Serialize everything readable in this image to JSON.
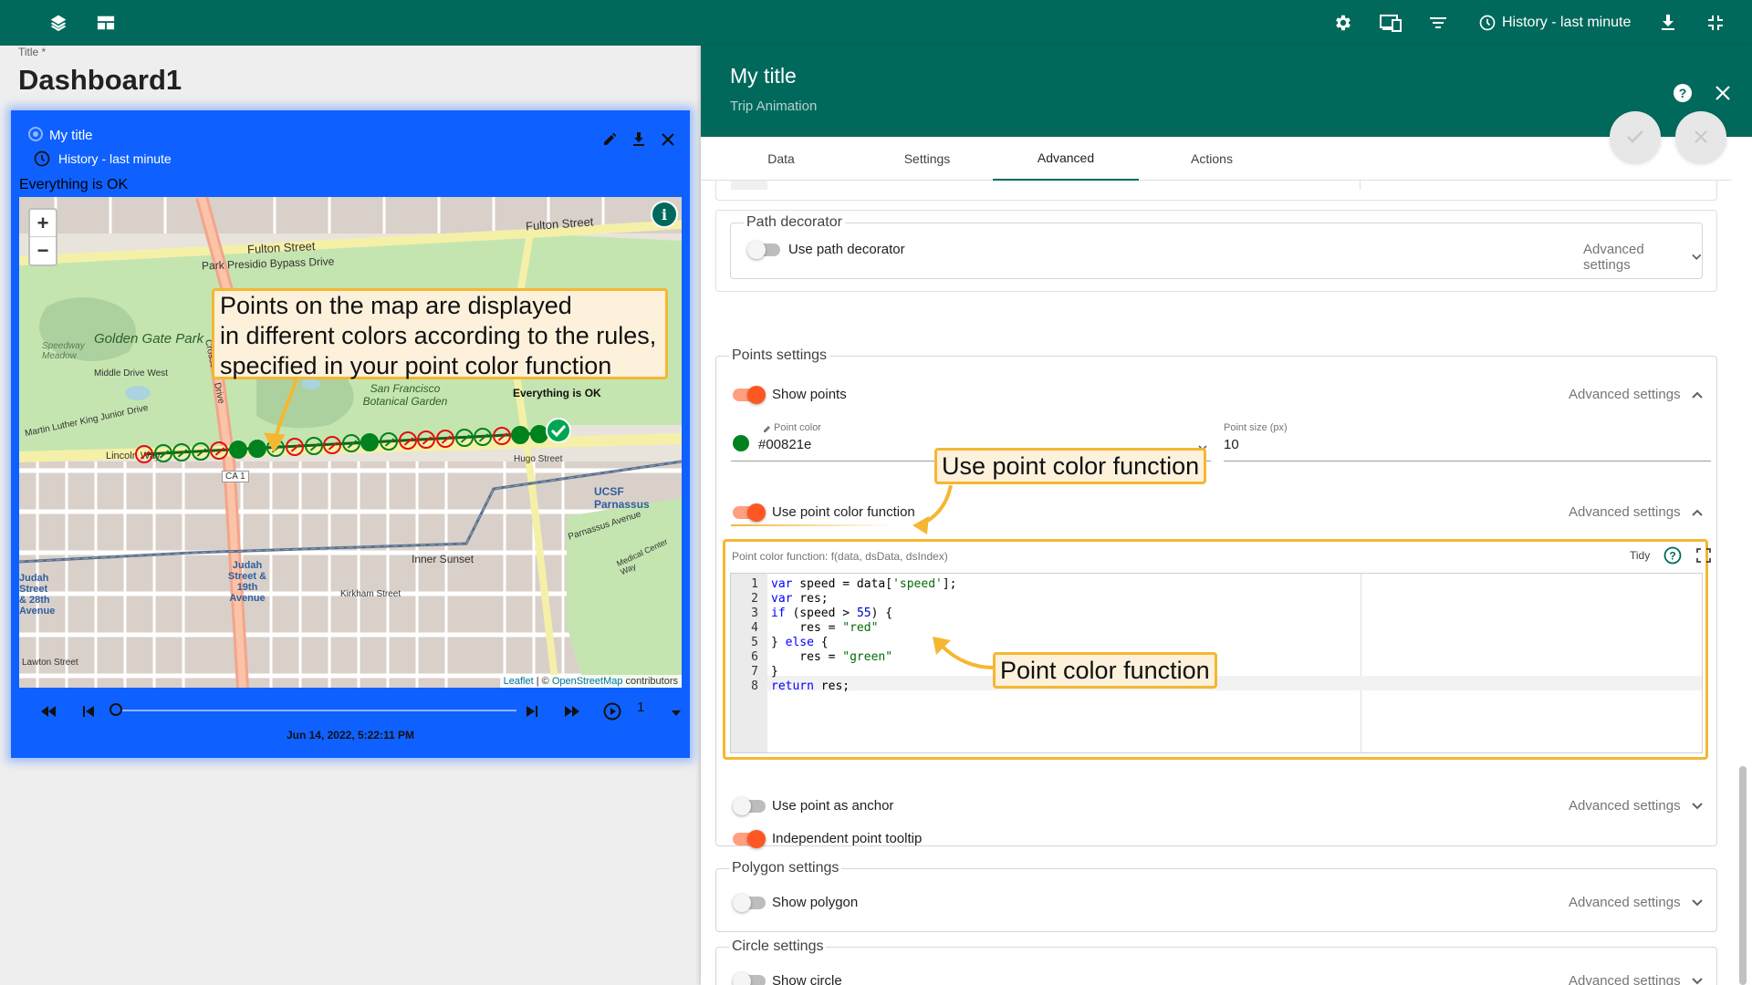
{
  "topbar": {
    "history_label": "History - last minute"
  },
  "dashboard": {
    "title_label": "Title *",
    "title": "Dashboard1"
  },
  "widget": {
    "title": "My title",
    "history": "History - last minute",
    "status": "Everything is OK",
    "map": {
      "zoom_in": "+",
      "zoom_out": "−",
      "info": "i",
      "attribution_leaflet": "Leaflet",
      "attribution_sep": " | © ",
      "attribution_osm": "OpenStreetMap",
      "attribution_rest": " contributors",
      "labels": {
        "fulton_street": "Fulton Street",
        "fulton_street_2": "Fulton Street",
        "park_presidio": "Park Presidio Bypass Drive",
        "golden_gate_park": "Golden Gate Park",
        "speedway_meadow": "Speedway Meadow",
        "middle_drive": "Middle Drive West",
        "sf_botanical": "San Francisco Botanical Garden",
        "crossover_drive": "Crossover Drive",
        "martin_luther_king": "Martin Luther King Junior Drive",
        "lincoln_way": "Lincoln Way",
        "ca1": "CA 1",
        "hugo_street": "Hugo Street",
        "ucsf": "UCSF Parnassus",
        "parnassus_ave": "Parnassus Avenue",
        "inner_sunset": "Inner Sunset",
        "judah_19th": "Judah Street & 19th Avenue",
        "judah_28th": "Judah Street & 28th Avenue",
        "kirkham": "Kirkham Street",
        "lawton": "Lawton Street",
        "medical_center": "Medical Center Way",
        "everything_ok": "Everything is OK"
      },
      "track_points": [
        {
          "color": "#e01010",
          "fill": false
        },
        {
          "color": "#00821e",
          "fill": false
        },
        {
          "color": "#00821e",
          "fill": false
        },
        {
          "color": "#00821e",
          "fill": false
        },
        {
          "color": "#e01010",
          "fill": false
        },
        {
          "color": "#00821e",
          "fill": true
        },
        {
          "color": "#00821e",
          "fill": true
        },
        {
          "color": "#00821e",
          "fill": false
        },
        {
          "color": "#e01010",
          "fill": false
        },
        {
          "color": "#00821e",
          "fill": false
        },
        {
          "color": "#e01010",
          "fill": false
        },
        {
          "color": "#00821e",
          "fill": false
        },
        {
          "color": "#00821e",
          "fill": true
        },
        {
          "color": "#00821e",
          "fill": false
        },
        {
          "color": "#e01010",
          "fill": false
        },
        {
          "color": "#e01010",
          "fill": false
        },
        {
          "color": "#e01010",
          "fill": false
        },
        {
          "color": "#00821e",
          "fill": false
        },
        {
          "color": "#00821e",
          "fill": false
        },
        {
          "color": "#e01010",
          "fill": false
        },
        {
          "color": "#00821e",
          "fill": true
        },
        {
          "color": "#00821e",
          "fill": true
        }
      ]
    },
    "player": {
      "timestamp": "Jun 14, 2022, 5:22:11 PM",
      "speed": "1"
    }
  },
  "callouts": {
    "map_note": "Points on the map are displayed\nin different colors according to the rules,\nspecified in your point color function",
    "use_point_color_function": "Use point color function",
    "point_color_function": "Point color function"
  },
  "panel": {
    "title": "My title",
    "subtitle": "Trip Animation",
    "tabs": [
      {
        "label": "Data"
      },
      {
        "label": "Settings"
      },
      {
        "label": "Advanced",
        "active": true
      },
      {
        "label": "Actions"
      }
    ],
    "path_decorator": {
      "legend": "Path decorator",
      "toggle_label": "Use path decorator",
      "toggle_on": false,
      "advanced": "Advanced settings"
    },
    "points_settings": {
      "legend": "Points settings",
      "show_points": {
        "label": "Show points",
        "on": true,
        "advanced": "Advanced settings"
      },
      "point_color": {
        "label": "Point color",
        "value": "#00821e",
        "swatch": "#00821e"
      },
      "point_size": {
        "label": "Point size (px)",
        "value": "10"
      },
      "use_point_color_function": {
        "label": "Use point color function",
        "on": true,
        "advanced": "Advanced settings"
      },
      "function_editor": {
        "label": "Point color function: f(data, dsData, dsIndex)",
        "tidy": "Tidy",
        "lines": [
          "var speed = data['speed'];",
          "var res;",
          "if (speed > 55) {",
          "    res = \"red\"",
          "} else {",
          "    res = \"green\"",
          "}",
          "return res;"
        ]
      },
      "use_point_as_anchor": {
        "label": "Use point as anchor",
        "on": false,
        "advanced": "Advanced settings"
      },
      "independent_point_tooltip": {
        "label": "Independent point tooltip",
        "on": true
      }
    },
    "polygon_settings": {
      "legend": "Polygon settings",
      "toggle_label": "Show polygon",
      "on": false,
      "advanced": "Advanced settings"
    },
    "circle_settings": {
      "legend": "Circle settings",
      "toggle_label": "Show circle",
      "on": false,
      "advanced": "Advanced settings"
    }
  },
  "colors": {
    "primary": "#00695c",
    "widget_bg": "#0f61ff",
    "toggle_on": "#ff5722",
    "callout_border": "#f5b731",
    "callout_bg": "#fdf1dc",
    "point_red": "#e01010",
    "point_green": "#00821e"
  }
}
